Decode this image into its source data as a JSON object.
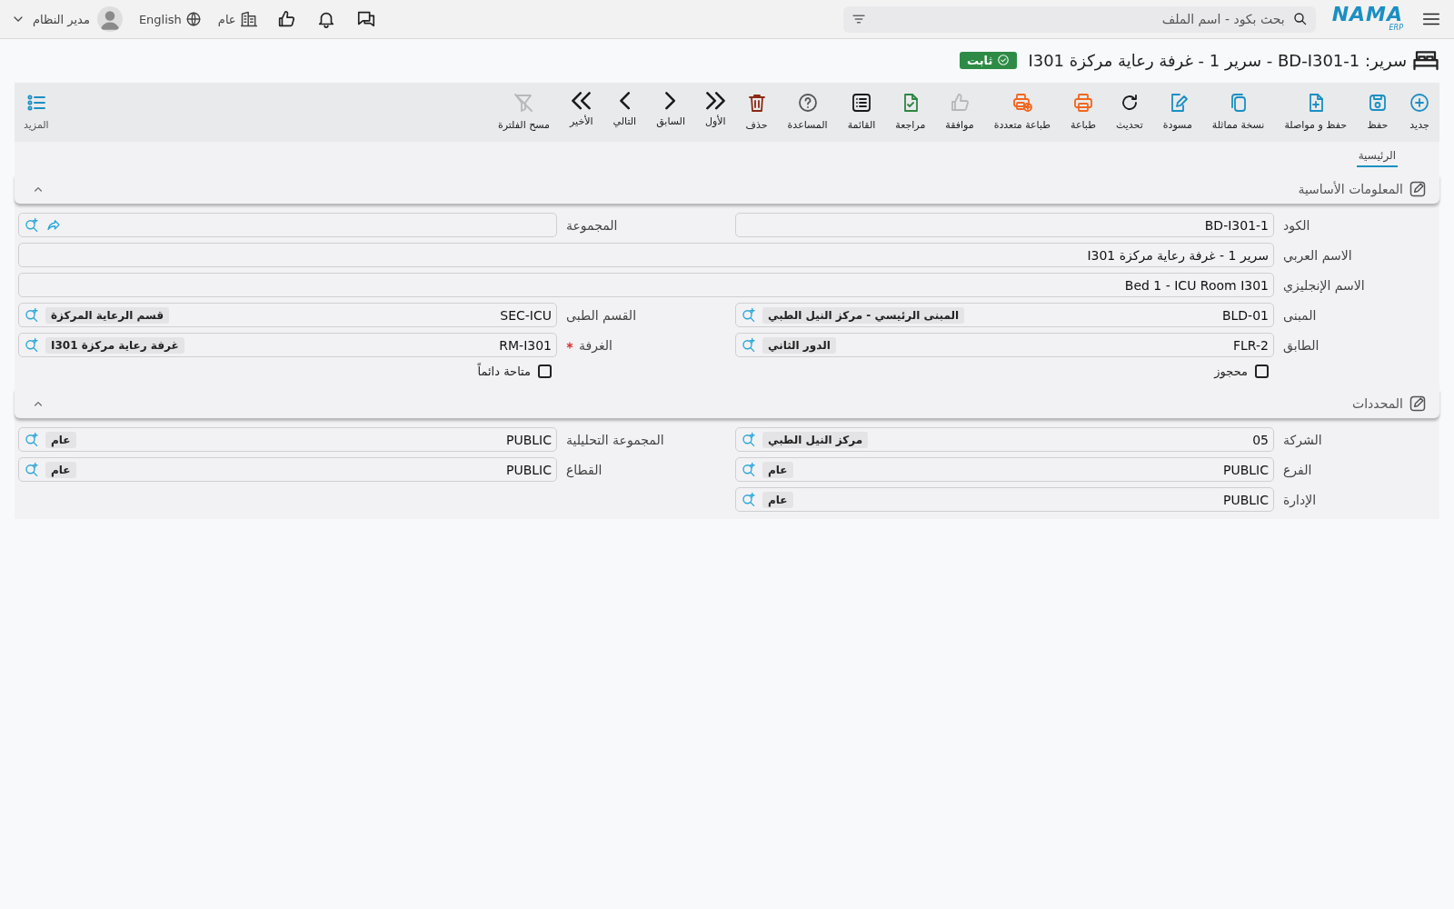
{
  "topbar": {
    "logo": {
      "name": "NAMA",
      "sub": "ERP"
    },
    "search": {
      "placeholder": "بحث بكود - اسم الملف"
    },
    "user": {
      "name": "مدير النظام"
    },
    "language": "English",
    "branch": "عام"
  },
  "title": {
    "text": "سرير: BD-I301-1 - سرير 1 - غرفة رعاية مركزة I301",
    "badge": "ثابت"
  },
  "toolbar": [
    {
      "kind": "new",
      "label": "جديد",
      "color": "#1b8fc2"
    },
    {
      "kind": "save",
      "label": "حفظ",
      "color": "#1b8fc2"
    },
    {
      "kind": "save_continue",
      "label": "حفظ و مواصلة",
      "color": "#1b8fc2"
    },
    {
      "kind": "duplicate",
      "label": "نسخة مماثلة",
      "color": "#1b8fc2"
    },
    {
      "kind": "draft",
      "label": "مسودة",
      "color": "#1b8fc2"
    },
    {
      "kind": "refresh",
      "label": "تحديث",
      "color": "#1a1a1a"
    },
    {
      "kind": "print",
      "label": "طباعة",
      "color": "#f2661c"
    },
    {
      "kind": "print_multi",
      "label": "طباعة متعددة",
      "color": "#f2661c"
    },
    {
      "kind": "approve",
      "label": "موافقة",
      "color": "#b8b8b8"
    },
    {
      "kind": "review",
      "label": "مراجعة",
      "color": "#2e8540"
    },
    {
      "kind": "list",
      "label": "القائمة",
      "color": "#1a1a1a"
    },
    {
      "kind": "help",
      "label": "المساعدة",
      "color": "#555555"
    },
    {
      "kind": "delete",
      "label": "حذف",
      "color": "#8a2a14"
    },
    {
      "kind": "first",
      "label": "الأول",
      "color": "#1a1a1a"
    },
    {
      "kind": "previous",
      "label": "السابق",
      "color": "#1a1a1a"
    },
    {
      "kind": "next",
      "label": "التالي",
      "color": "#1a1a1a"
    },
    {
      "kind": "last",
      "label": "الأخير",
      "color": "#1a1a1a"
    },
    {
      "kind": "clear_filter",
      "label": "مسح الفلترة",
      "color": "#b8b8b8"
    }
  ],
  "more_button": {
    "label": "المزيد"
  },
  "tabs": [
    {
      "label": "الرئيسية",
      "selected": true
    }
  ],
  "sections": [
    {
      "title": "المعلومات الأساسية",
      "expanded": true,
      "fields": [
        {
          "kind": "text",
          "label": "الكود",
          "value": "BD-I301-1"
        },
        {
          "kind": "group",
          "label": "المجموعة"
        },
        {
          "kind": "wide_text",
          "label": "الاسم العربي",
          "value": "سرير 1 - غرفة رعاية مركزة I301"
        },
        {
          "kind": "wide_text",
          "label": "الاسم الإنجليزي",
          "value": "Bed 1 - ICU Room I301"
        },
        {
          "kind": "lookup",
          "label": "المبنى",
          "value": "BLD-01",
          "description": "المبنى الرئيسي - مركز النيل الطبي",
          "required": false
        },
        {
          "kind": "lookup",
          "label": "القسم الطبى",
          "value": "SEC-ICU",
          "description": "قسم الرعاية المركزة",
          "required": false
        },
        {
          "kind": "lookup",
          "label": "الطابق",
          "value": "FLR-2",
          "description": "الدور الثاني",
          "required": false
        },
        {
          "kind": "lookup",
          "label": "الغرفة",
          "value": "RM-I301",
          "description": "غرفة رعاية مركزة I301",
          "required": true
        },
        {
          "kind": "checkbox",
          "label": "محجوز",
          "checked": false
        },
        {
          "kind": "checkbox",
          "label": "متاحة دائماً",
          "checked": false
        }
      ]
    },
    {
      "title": "المحددات",
      "expanded": true,
      "fields": [
        {
          "kind": "lookup",
          "label": "الشركة",
          "value": "05",
          "description": "مركز النيل الطبي",
          "required": false
        },
        {
          "kind": "lookup",
          "label": "المجموعة التحليلية",
          "value": "PUBLIC",
          "description": "عام",
          "required": false
        },
        {
          "kind": "lookup",
          "label": "الفرع",
          "value": "PUBLIC",
          "description": "عام",
          "required": false
        },
        {
          "kind": "lookup",
          "label": "القطاع",
          "value": "PUBLIC",
          "description": "عام",
          "required": false
        },
        {
          "kind": "lookup",
          "label": "الإدارة",
          "value": "PUBLIC",
          "description": "عام",
          "required": false
        }
      ]
    }
  ]
}
